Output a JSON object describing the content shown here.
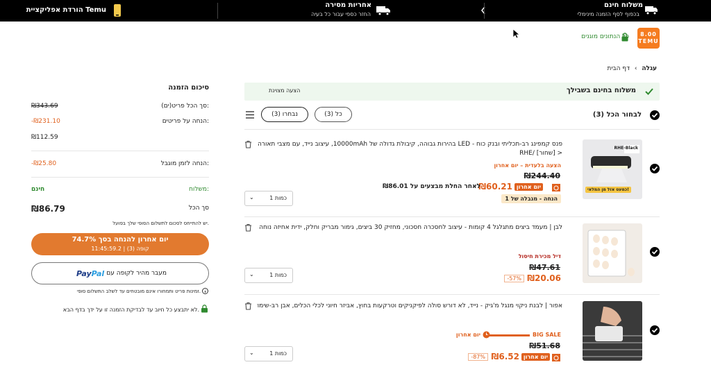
{
  "topbar": {
    "shipping": {
      "title": "משלוח חינם",
      "subtitle": "בכפוף לסף הזמנה מינימלי"
    },
    "delivery": {
      "title": "אחריות מסירה",
      "subtitle": "החזר כספי עבור כל בעיה"
    },
    "app": {
      "title": "הורדת אפליקציית Temu"
    }
  },
  "header": {
    "logo_top": "8.00",
    "logo_bottom": "TEMU",
    "secure_text": "כל הנתונים מוגנים"
  },
  "breadcrumb": {
    "home": "דף הבית",
    "current": "עגלה"
  },
  "free_shipping_bar": {
    "title": "משלוח בחינם בשבילך",
    "offer": "הצעה מצוינת"
  },
  "selection": {
    "select_all": "לבחור הכל (3)",
    "all_pill": "כל (3)",
    "selected_pill": "נבחרו (3)"
  },
  "items": [
    {
      "title": "פנס קמפינג רב-תכליתי ובנק כוח - LED בהירות גבוהה, קיבולת גדולה של 10000mAh, עיצוב נייד, עם מצבי תאורה מרובים",
      "variant": "RHE/ [שחור] >",
      "promo": "הצעה בלעדית – יום אחרון",
      "old_price": "₪244.40",
      "tag": "יום אחרון",
      "new_price": "₪60.21",
      "after_promo": "לאחר החלת מבצעים על ₪86.01",
      "limit": "הנחה - מגבלה של 1",
      "quantity": "כמות 1",
      "thumb_label": "כמעט אזל מן המלאי!",
      "thumb_badge": "RHE-Black"
    },
    {
      "title": "לבן | מעמד ביצים מתגלגל 4 קומות - עיצוב לחסכרה חסכוני, מחזיק 30 ביצים, גימור מבריק וחלק, ידית אחיזה נוחה | מתאים ל...",
      "promo": "דיל מכירת חיסול",
      "old_price": "₪47.61",
      "new_price": "₪20.06",
      "discount": "-57%",
      "quantity": "כמות 1"
    },
    {
      "title": "אפור | לבנת ניקוי מנגל מ'גיק - נייד, לא דורש סולה לפיקניקים וטרקעות בחוץ, אביזר חיוני לכלי הכלים, אבן רב-שימושית",
      "sale_tag": "BIG SALE",
      "sale_last": "יום אחרון",
      "old_price": "₪51.68",
      "tag": "יום אחרון",
      "new_price": "₪6.52",
      "discount": "-87%",
      "quantity": "כמות 1"
    }
  ],
  "summary": {
    "title": "סיכום הזמנה",
    "rows": [
      {
        "label": "סך הכל פריט(ים):",
        "value": "₪343.69"
      },
      {
        "label": "הנחה על פריטים:",
        "value": "-₪231.10"
      },
      {
        "label": "",
        "value": "₪112.59"
      },
      {
        "label": "הנחה לזמן מוגבל:",
        "value": "-₪25.80"
      },
      {
        "label": "משלוח:",
        "value": "חינם"
      },
      {
        "label": "סך הכל",
        "value": "₪86.79"
      }
    ],
    "tax_note": "יש להתייחס לסכום לתשלום הסופי שלך בפועל.",
    "checkout_line1": "יום אחרון להנחה בסך 74.7%",
    "checkout_line2": "קופה (3) | 11:45:59.2",
    "paypal_text": "מעבר מהיר לקופה עם",
    "paypal_logo_1": "Pay",
    "paypal_logo_2": "Pal",
    "stock_note": "זמינות פריט ותמחורו אינם מובטחים עד לשלב התשלום סופי.",
    "secure_note": "לא יתבצע כל חיוב עד לבדיקת הזמנה זו על ידך בדף הבא."
  }
}
